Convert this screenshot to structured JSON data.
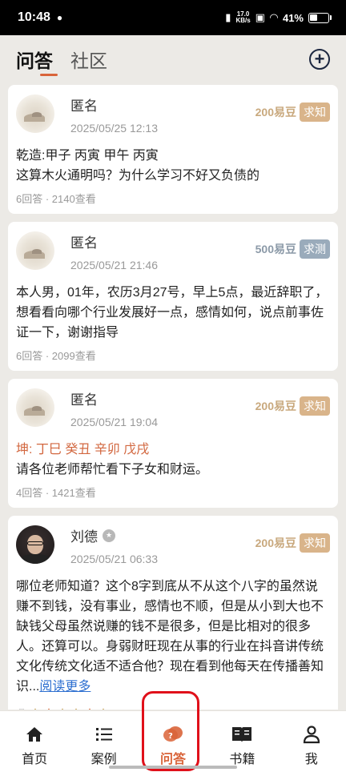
{
  "status_bar": {
    "time": "10:48",
    "net_speed_top": "17.0",
    "net_speed_unit": "KB/s",
    "battery": "41%"
  },
  "header": {
    "tabs": [
      {
        "label": "问答",
        "active": true
      },
      {
        "label": "社区",
        "active": false
      }
    ],
    "add_icon": "plus-circle-icon"
  },
  "posts": [
    {
      "user": "匿名",
      "date": "2025/05/25 12:13",
      "beans": "200易豆",
      "tag": "求知",
      "tag_color": "#d9b48a",
      "bazi": "",
      "body": "乾造:甲子 丙寅 甲午 丙寅\n这算木火通明吗？为什么学习不好又负债的",
      "stats": "6回答 · 2140查看"
    },
    {
      "user": "匿名",
      "date": "2025/05/21 21:46",
      "beans": "500易豆",
      "tag": "求测",
      "tag_color": "#9aabbb",
      "bazi": "",
      "body": "本人男，01年，农历3月27号，早上5点，最近辞职了，想看看向哪个行业发展好一点，感情如何，说点前事佐证一下，谢谢指导",
      "stats": "6回答 · 2099查看"
    },
    {
      "user": "匿名",
      "date": "2025/05/21 19:04",
      "beans": "200易豆",
      "tag": "求知",
      "tag_color": "#d9b48a",
      "bazi": "坤: 丁巳 癸丑 辛卯 戊戌",
      "body": "请各位老师帮忙看下子女和财运。",
      "stats": "4回答 · 1421查看"
    },
    {
      "user": "刘德",
      "date": "2025/05/21 06:33",
      "beans": "200易豆",
      "tag": "求知",
      "tag_color": "#d9b48a",
      "bazi": "",
      "body": "哪位老师知道？这个8字到底从不从这个八字的虽然说赚不到钱，没有事业，感情也不顺，但是从小到大也不缺钱父母虽然说赚的钱不是很多，但是比相对的很多人。还算可以。身弱财旺现在从事的行业在抖音讲传统文化传统文化适不适合他？现在看到他每天在传播善知识...",
      "read_more": "阅读更多",
      "stats": ""
    }
  ],
  "bottom_nav": [
    {
      "label": "首页",
      "icon": "home-icon",
      "active": false
    },
    {
      "label": "案例",
      "icon": "list-icon",
      "active": false
    },
    {
      "label": "问答",
      "icon": "qa-bubble-icon",
      "active": true
    },
    {
      "label": "书籍",
      "icon": "book-icon",
      "active": false
    },
    {
      "label": "我",
      "icon": "person-icon",
      "active": false
    }
  ]
}
